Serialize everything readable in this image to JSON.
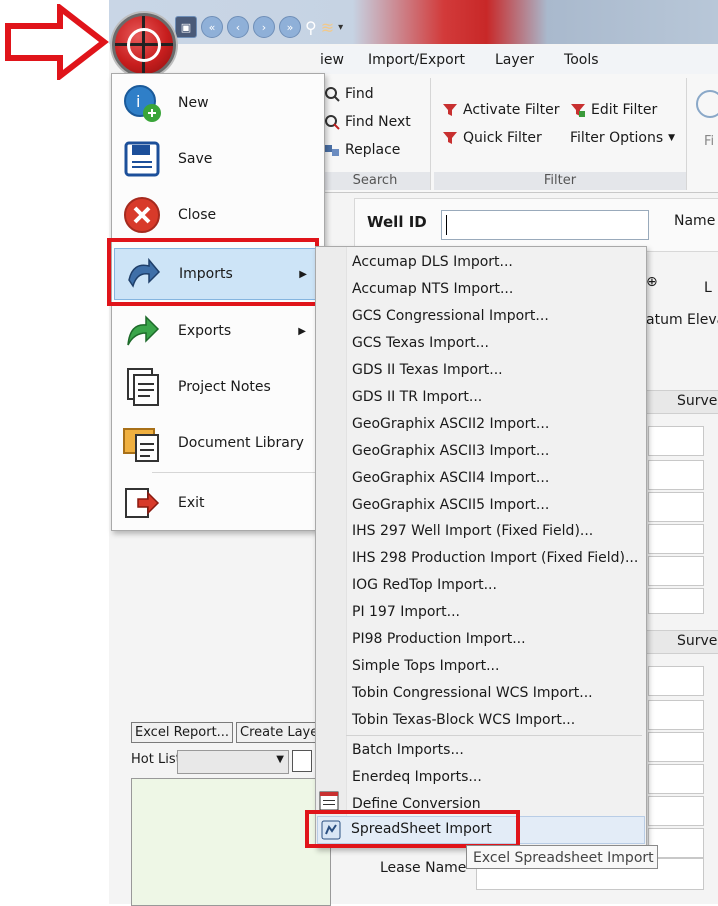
{
  "menu_tabs": [
    "iew",
    "Import/Export",
    "Layer",
    "Tools"
  ],
  "ribbon": {
    "search": {
      "find": "Find",
      "find_next": "Find Next",
      "replace": "Replace",
      "label": "Search"
    },
    "filter": {
      "activate": "Activate Filter",
      "quick": "Quick Filter",
      "edit": "Edit Filter",
      "options": "Filter Options",
      "label": "Filter"
    },
    "partial": "Fi"
  },
  "app_menu": {
    "items": [
      {
        "label": "New",
        "icon": "new-icon"
      },
      {
        "label": "Save",
        "icon": "save-icon"
      },
      {
        "label": "Close",
        "icon": "close-icon"
      },
      {
        "label": "Imports",
        "icon": "imports-icon"
      },
      {
        "label": "Exports",
        "icon": "exports-icon"
      },
      {
        "label": "Project Notes",
        "icon": "project-notes-icon"
      },
      {
        "label": "Document Library",
        "icon": "document-library-icon"
      },
      {
        "label": "Exit",
        "icon": "exit-icon"
      }
    ]
  },
  "imports_submenu": [
    "Accumap DLS Import...",
    "Accumap NTS Import...",
    "GCS Congressional Import...",
    "GCS Texas Import...",
    "GDS II Texas Import...",
    "GDS II TR Import...",
    "GeoGraphix ASCII2 Import...",
    "GeoGraphix ASCII3 Import...",
    "GeoGraphix ASCII4 Import...",
    "GeoGraphix ASCII5 Import...",
    "IHS 297 Well Import (Fixed Field)...",
    "IHS 298 Production Import (Fixed Field)...",
    "IOG RedTop Import...",
    "PI 197 Import...",
    "PI98 Production Import...",
    "Simple Tops Import...",
    "Tobin Congressional WCS Import...",
    "Tobin Texas-Block WCS Import...",
    "Batch Imports...",
    "Enerdeq Imports...",
    "Define Conversion",
    "SpreadSheet Import"
  ],
  "tooltip": "Excel Spreadsheet Import",
  "form": {
    "well_id_label": "Well ID",
    "name_label": "Name",
    "partial_le": "L",
    "datum_partial": "atum Elevat",
    "survey_partial": "Surve",
    "lease_label": "Lease Name"
  },
  "left_panel": {
    "excel_report": "Excel Report...",
    "create_layer": "Create Laye",
    "hot_list": "Hot List"
  },
  "colors": {
    "highlight": "#e0141a",
    "accent": "#cde4f7"
  }
}
